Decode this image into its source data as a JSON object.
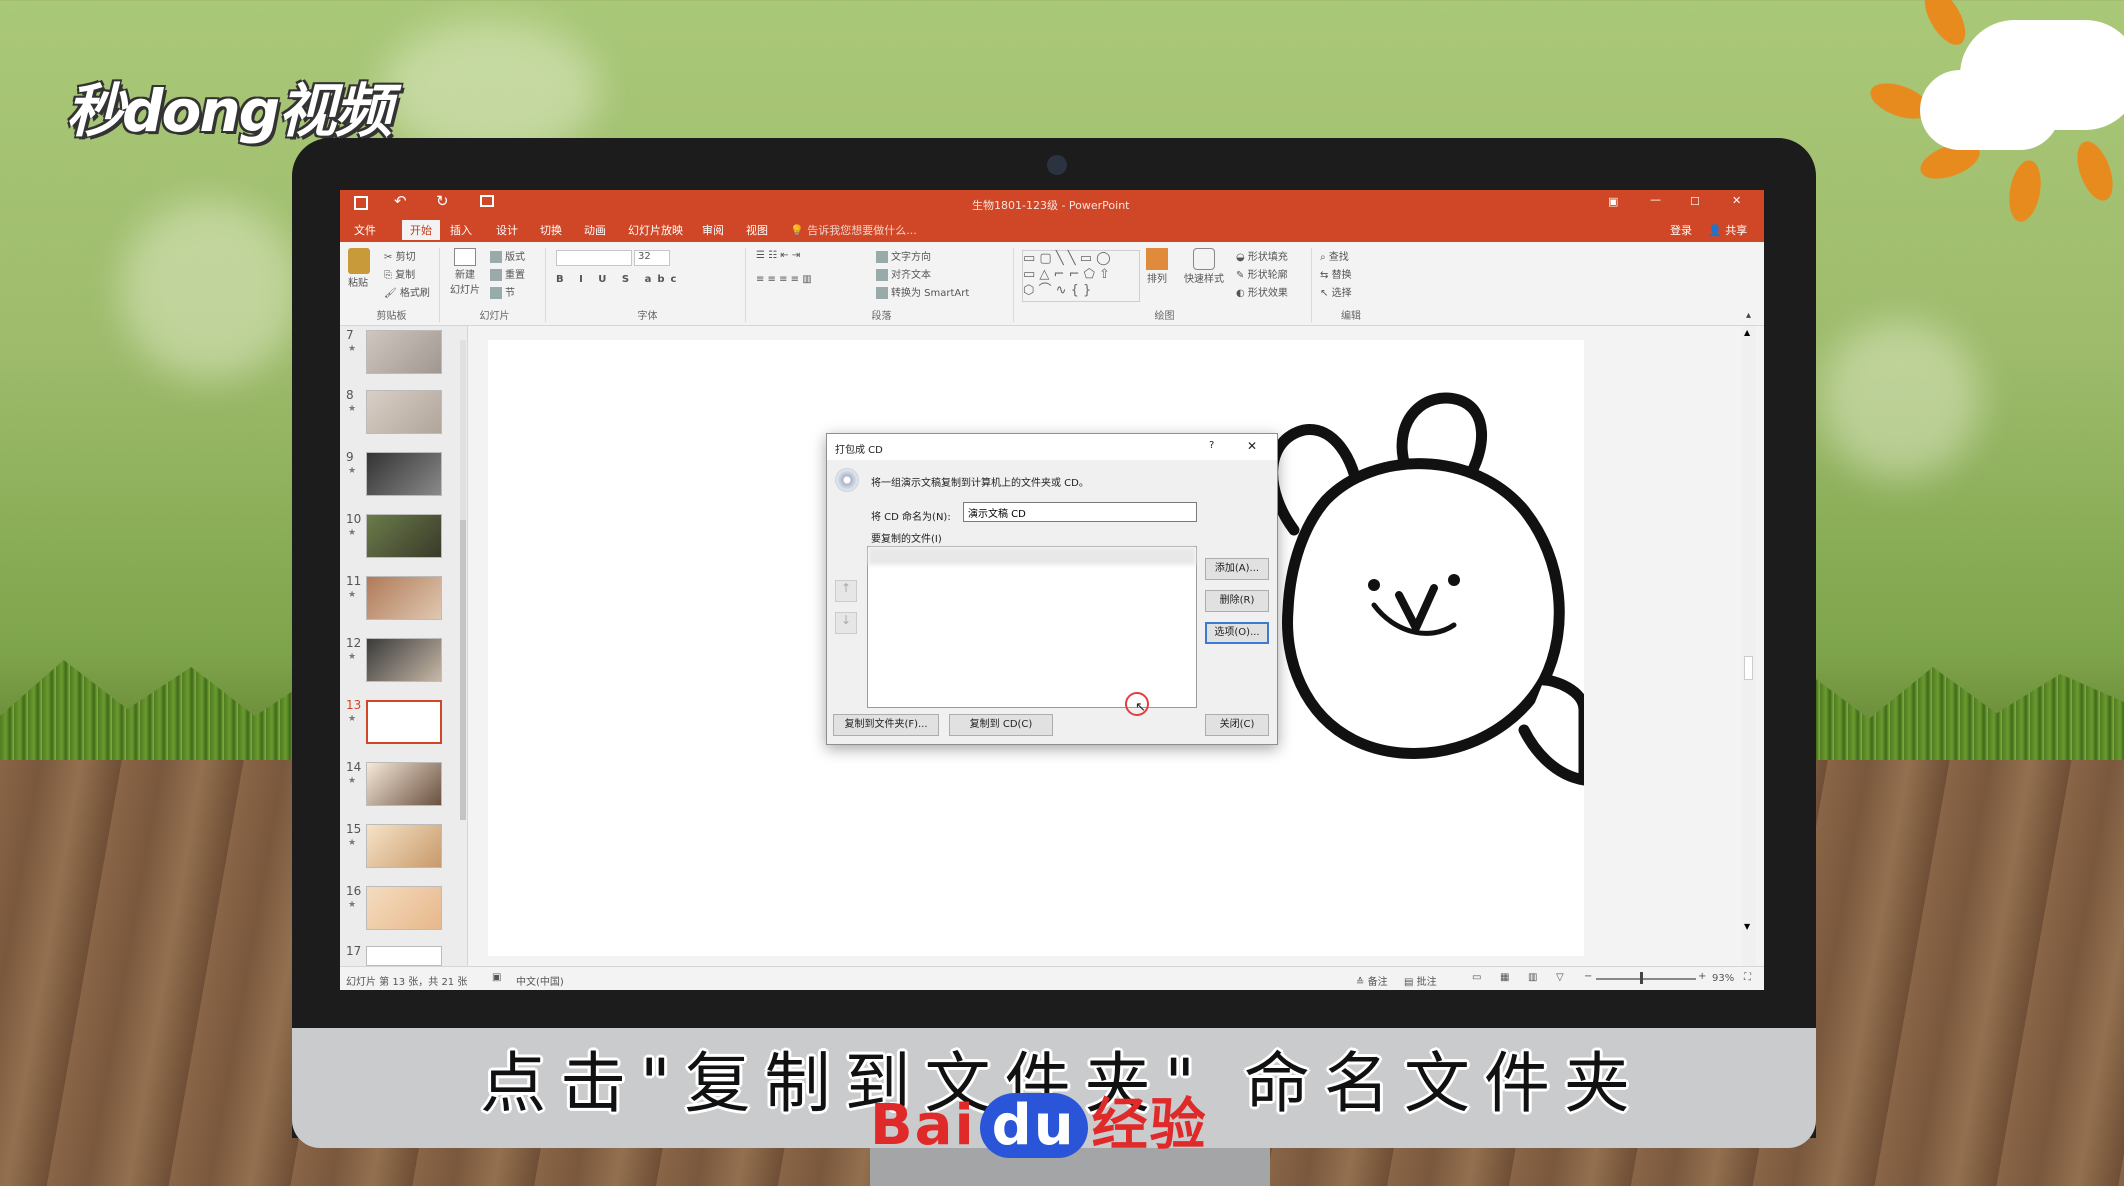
{
  "branding": {
    "logo_text": "秒dong视频",
    "subtitle": "点击\"复制到文件夹\" 命名文件夹",
    "watermark_bai": "Bai",
    "watermark_du": "du",
    "watermark_jingyan": "经验"
  },
  "app": {
    "title": "生物1801-123级 - PowerPoint",
    "signin": "登录",
    "share": "共享",
    "tell_me": "告诉我您想要做什么...",
    "tabs": [
      "文件",
      "开始",
      "插入",
      "设计",
      "切换",
      "动画",
      "幻灯片放映",
      "审阅",
      "视图"
    ],
    "active_tab": "开始"
  },
  "ribbon": {
    "clipboard": {
      "label": "剪贴板",
      "paste": "粘贴",
      "cut": "剪切",
      "copy": "复制",
      "format_painter": "格式刷"
    },
    "slides": {
      "label": "幻灯片",
      "new_slide": "新建\n幻灯片",
      "layout": "版式",
      "reset": "重置",
      "section": "节"
    },
    "font": {
      "label": "字体",
      "size": "32"
    },
    "paragraph": {
      "label": "段落",
      "text_direction": "文字方向",
      "align_text": "对齐文本",
      "smartart": "转换为 SmartArt"
    },
    "drawing": {
      "label": "绘图",
      "arrange": "排列",
      "quick_styles": "快速样式",
      "shape_fill": "形状填充",
      "shape_outline": "形状轮廓",
      "shape_effects": "形状效果"
    },
    "editing": {
      "label": "编辑",
      "find": "查找",
      "replace": "替换",
      "select": "选择"
    }
  },
  "slides_panel": {
    "numbers": [
      "7",
      "8",
      "9",
      "10",
      "11",
      "12",
      "13",
      "14",
      "15",
      "16",
      "17"
    ],
    "selected": "13"
  },
  "dialog": {
    "title": "打包成 CD",
    "help": "?",
    "close_x": "✕",
    "description": "将一组演示文稿复制到计算机上的文件夹或 CD。",
    "name_label": "将 CD 命名为(N):",
    "name_value": "演示文稿 CD",
    "files_label": "要复制的文件(I)",
    "add_button": "添加(A)...",
    "remove_button": "删除(R)",
    "options_button": "选项(O)...",
    "copy_to_folder_button": "复制到文件夹(F)...",
    "copy_to_cd_button": "复制到 CD(C)",
    "close_button": "关闭(C)"
  },
  "statusbar": {
    "slide_info": "幻灯片 第 13 张，共 21 张",
    "language": "中文(中国)",
    "notes": "备注",
    "comments": "批注",
    "zoom": "93%"
  }
}
